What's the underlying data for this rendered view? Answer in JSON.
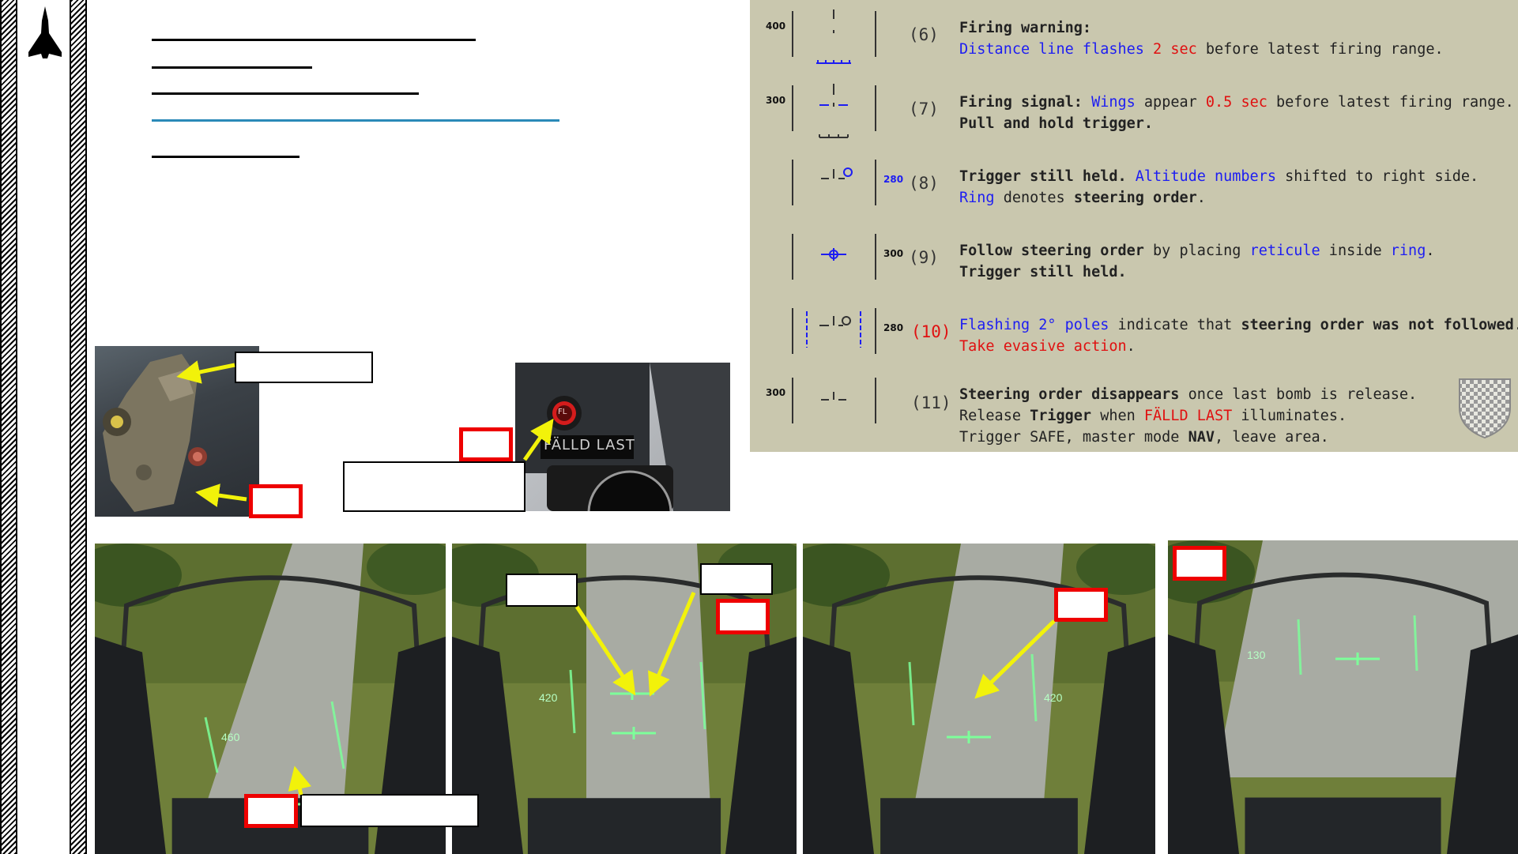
{
  "slide": {
    "logo_icon": "aircraft-silhouette-icon",
    "title_lines": [
      {
        "style": "dark"
      },
      {
        "style": "dark"
      },
      {
        "style": "dark"
      },
      {
        "style": "blue"
      },
      {
        "style": "dark"
      }
    ]
  },
  "hud_steps": [
    {
      "alt_left": "400",
      "alt_right": "",
      "number": "(6)",
      "number_red": false,
      "line1": [
        [
          "Firing warning:",
          "b"
        ]
      ],
      "line2": [
        [
          "Distance line flashes ",
          "blue"
        ],
        [
          "2 sec",
          "red"
        ],
        [
          " before latest firing range.",
          ""
        ]
      ]
    },
    {
      "alt_left": "300",
      "alt_right": "",
      "number": "(7)",
      "number_red": false,
      "line1": [
        [
          "Firing signal: ",
          "b"
        ],
        [
          "Wings",
          "blue"
        ],
        [
          " appear ",
          ""
        ],
        [
          "0.5 sec",
          "red"
        ],
        [
          " before latest firing range.",
          ""
        ]
      ],
      "line2": [
        [
          "Pull and hold trigger.",
          "b"
        ]
      ]
    },
    {
      "alt_left": "",
      "alt_right": "280",
      "alt_right_blue": true,
      "number": "(8)",
      "number_red": false,
      "line1": [
        [
          "Trigger still held. ",
          "b"
        ],
        [
          "Altitude numbers",
          "blue"
        ],
        [
          " shifted to right side.",
          ""
        ]
      ],
      "line2": [
        [
          "Ring",
          "blue"
        ],
        [
          " denotes ",
          ""
        ],
        [
          "steering order",
          "b"
        ],
        [
          ".",
          ""
        ]
      ]
    },
    {
      "alt_left": "",
      "alt_right": "300",
      "alt_right_blue": false,
      "number": "(9)",
      "number_red": false,
      "line1": [
        [
          "Follow steering order",
          "b"
        ],
        [
          " by placing ",
          ""
        ],
        [
          "reticule",
          "blue"
        ],
        [
          " inside ",
          ""
        ],
        [
          "ring",
          "blue"
        ],
        [
          ".",
          ""
        ]
      ],
      "line2": [
        [
          "Trigger still held.",
          "b"
        ]
      ]
    },
    {
      "alt_left": "",
      "alt_right": "280",
      "alt_right_blue": false,
      "number": "(10)",
      "number_red": true,
      "line1": [
        [
          "Flashing 2° poles",
          "blue"
        ],
        [
          " indicate that ",
          ""
        ],
        [
          "steering order was not followed",
          "b"
        ],
        [
          ".",
          ""
        ]
      ],
      "line2": [
        [
          "Take evasive action",
          "red"
        ],
        [
          ".",
          ""
        ]
      ]
    },
    {
      "alt_left": "300",
      "alt_right": "",
      "number": "(11)",
      "number_red": false,
      "line1": [
        [
          "Steering order disappears",
          "b"
        ],
        [
          " once last bomb is release.",
          ""
        ]
      ],
      "line2": [
        [
          "Release ",
          ""
        ],
        [
          "Trigger",
          "b"
        ],
        [
          " when ",
          ""
        ],
        [
          "FÄLLD LAST",
          "red"
        ],
        [
          " illuminates.",
          ""
        ]
      ],
      "line3": [
        [
          "Trigger SAFE",
          ""
        ],
        [
          ", master mode ",
          ""
        ],
        [
          "NAV",
          "b"
        ],
        [
          ", leave area.",
          ""
        ]
      ]
    }
  ],
  "panel": {
    "fall_last_label": "FÄLLD LAST",
    "fall_last_button": "FL",
    "emblem_icon": "checkered-shield-icon"
  },
  "hud_photos": [
    {
      "alt": "460"
    },
    {
      "alt": "420"
    },
    {
      "alt": "420"
    },
    {
      "alt": "130"
    }
  ],
  "colors": {
    "panel_bg": "#c9c7ae",
    "blue": "#1d1df2",
    "red": "#e01010",
    "hud_green": "#7dff9a",
    "callout_red": "#e00000",
    "arrow_yellow": "#f2f20a"
  }
}
